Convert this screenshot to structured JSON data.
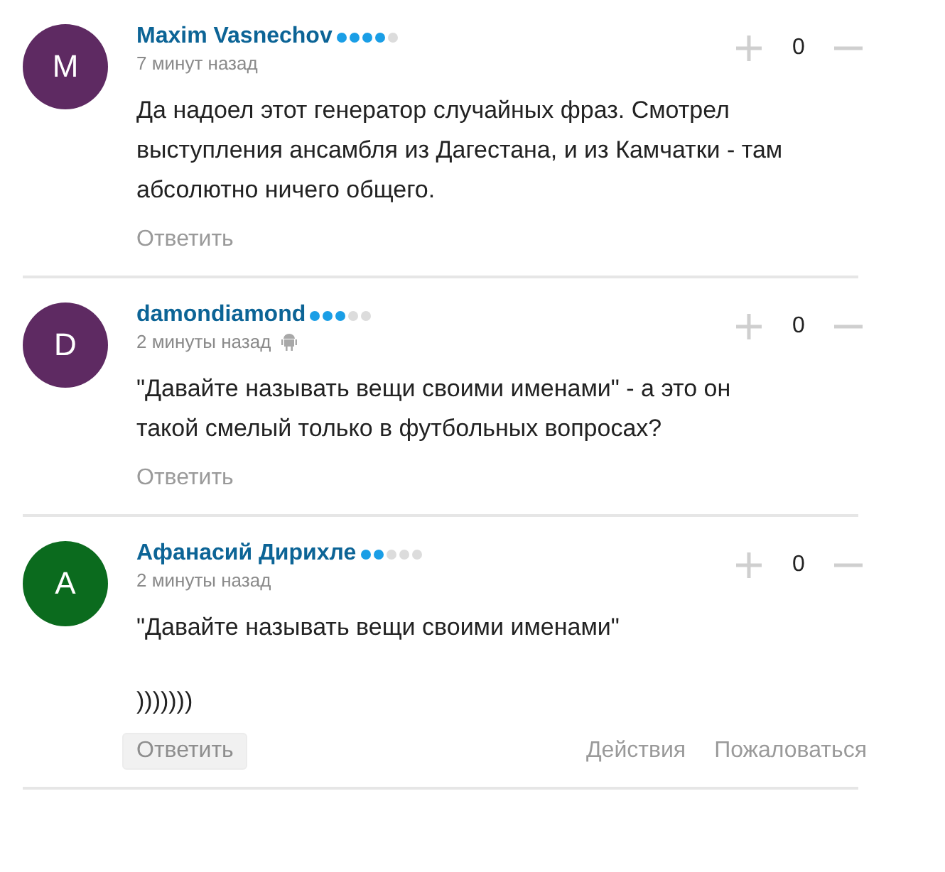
{
  "comments": [
    {
      "initial": "M",
      "color": "#5e2a62",
      "author": "Maxim Vasnechov",
      "stars": 4,
      "time": "7 минут назад",
      "mobile": false,
      "score": "0",
      "body": [
        "Да надоел этот генератор случайных фраз. Смотрел выступления ансамбля из Дагестана, и из Камчатки - там абсолютно ничего общего."
      ],
      "reply": {
        "label": "Ответить",
        "highlighted": false
      }
    },
    {
      "initial": "D",
      "color": "#5e2a62",
      "author": "damondiamond",
      "stars": 3,
      "time": "2 минуты назад",
      "mobile": true,
      "score": "0",
      "body": [
        "\"Давайте называть вещи своими именами\" - а это он такой смелый только в футбольных вопросах?"
      ],
      "reply": {
        "label": "Ответить",
        "highlighted": false
      }
    },
    {
      "initial": "A",
      "color": "#0b6b1e",
      "author": "Афанасий Дирихле",
      "stars": 2,
      "time": "2 минуты назад",
      "mobile": false,
      "score": "0",
      "body": [
        "\"Давайте называть вещи своими именами\"",
        ")))))))"
      ],
      "reply": {
        "label": "Ответить",
        "highlighted": true
      },
      "actions": [
        "Действия",
        "Пожаловаться"
      ]
    }
  ]
}
